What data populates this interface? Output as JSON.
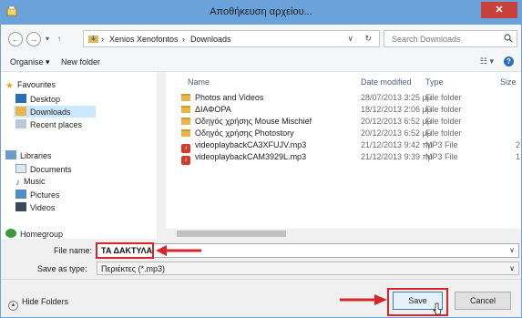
{
  "window": {
    "title": "Αποθήκευση αρχείου...",
    "close_label": "✕"
  },
  "address": {
    "crumbs": [
      "Xenios Xenofontos",
      "Downloads"
    ],
    "separator": "›",
    "search_placeholder": "Search Downloads"
  },
  "toolbar": {
    "organise_label": "Organise ▾",
    "new_folder_label": "New folder",
    "help_label": "?"
  },
  "navigation": {
    "favourites": "Favourites",
    "desktop": "Desktop",
    "downloads": "Downloads",
    "recent": "Recent places",
    "libraries": "Libraries",
    "documents": "Documents",
    "music": "Music",
    "pictures": "Pictures",
    "videos": "Videos",
    "homegroup": "Homegroup"
  },
  "columns": {
    "name": "Name",
    "date": "Date modified",
    "type": "Type",
    "size": "Size"
  },
  "files": [
    {
      "name": "Photos and Videos",
      "date": "28/07/2013 3:25 μμ",
      "type": "File folder",
      "size": "",
      "kind": "folder"
    },
    {
      "name": "ΔΙΑΦΟΡΑ",
      "date": "18/12/2013 2:06 μμ",
      "type": "File folder",
      "size": "",
      "kind": "folder"
    },
    {
      "name": "Οδηγός χρήσης Mouse Mischief",
      "date": "20/12/2013 6:52 μμ",
      "type": "File folder",
      "size": "",
      "kind": "folder"
    },
    {
      "name": "Οδηγός χρήσης Photostory",
      "date": "20/12/2013 6:52 μμ",
      "type": "File folder",
      "size": "",
      "kind": "folder"
    },
    {
      "name": "videoplaybackCA3XFUJV.mp3",
      "date": "21/12/2013 9:42 πμ",
      "type": "MP3 File",
      "size": "2",
      "kind": "mp3"
    },
    {
      "name": "videoplaybackCAM3929L.mp3",
      "date": "21/12/2013 9:39 πμ",
      "type": "MP3 File",
      "size": "1",
      "kind": "mp3"
    }
  ],
  "form": {
    "filename_label": "File name:",
    "filename_value": "ΤΑ ΔΑΚΤΥΛΑ",
    "savetype_label": "Save as type:",
    "savetype_value": "Περιέκτες (*.mp3)"
  },
  "footer": {
    "hide_folders": "Hide Folders",
    "save": "Save",
    "cancel": "Cancel"
  },
  "colors": {
    "titlebar": "#6aa3db",
    "highlight": "#d7262b",
    "selection": "#cce8ff"
  }
}
